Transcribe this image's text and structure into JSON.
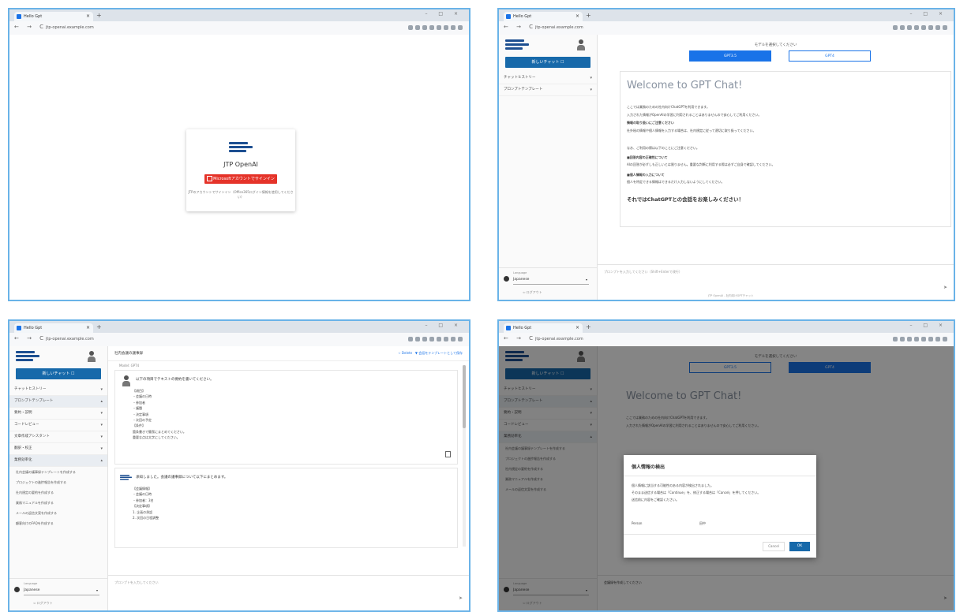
{
  "browser": {
    "tab_title": "Hello Gpt",
    "url": "jtp-openai.example.com",
    "new_tab": "+",
    "close": "×",
    "nav": "← → C",
    "window_controls": "– □ ×"
  },
  "login": {
    "app_name": "JTP OpenAI",
    "signin_button": "Microsoftアカウントでサインイン",
    "note": "JTPのアカウントでサインイン（Office365ログイン情報を使用してください）"
  },
  "sidebar": {
    "new_chat_label": "新しいチャット ☐",
    "items": [
      {
        "label": "チャットヒストリー",
        "chev": "▾"
      },
      {
        "label": "プロンプトテンプレート",
        "chev": "▾"
      }
    ],
    "items_expanded": [
      {
        "label": "チャットヒストリー",
        "chev": "▾"
      },
      {
        "label": "プロンプトテンプレート",
        "chev": "▴"
      },
      {
        "label": "要約・説明",
        "chev": "▾"
      },
      {
        "label": "コードレビュー",
        "chev": "▾"
      },
      {
        "label": "文章作成アシスタント",
        "chev": "▾"
      },
      {
        "label": "翻訳・校正",
        "chev": "▾"
      },
      {
        "label": "業務効率化",
        "chev": "▴"
      }
    ],
    "sub_items": [
      "社内会議の議事録テンプレートを作成する",
      "プロジェクトの進捗報告を作成する",
      "社内規定の要約を作成する",
      "業務マニュアルを作成する",
      "メールの返信文案を作成する",
      "顧客向けのFAQを作成する"
    ],
    "lang_label": "Language",
    "lang_value": "Japanese",
    "lang_chev": "▾",
    "logout": "⇦ ログアウト"
  },
  "welcome": {
    "model_note": "モデルを選択してください",
    "model_a": "GPT3.5",
    "model_b": "GPT4",
    "title": "Welcome to GPT Chat!",
    "lines": [
      {
        "text": "ここでは業務のための社内向けChatGPTを利用できます。",
        "bold": false
      },
      {
        "text": "入力された情報がOpenAIの学習に利用されることはありませんので安心してご利用ください。",
        "bold": false
      },
      {
        "text": "情報の取り扱いにご注意ください",
        "bold": true
      },
      {
        "text": "社外秘の情報や個人情報を入力する場合は、社内規定に従って適切に取り扱ってください。",
        "bold": false
      },
      {
        "text": "なお、ご利用の際は以下のことにご注意ください。",
        "bold": false
      },
      {
        "text": "■回答内容の正確性について",
        "bold": true
      },
      {
        "text": "AIの回答が必ずしも正しいとは限りません。重要な判断に利用する際は必ずご自身で確認してください。",
        "bold": false
      },
      {
        "text": "■個人情報の入力について",
        "bold": true
      },
      {
        "text": "個人を特定できる情報はできるだけ入力しないようにしてください。",
        "bold": false
      }
    ],
    "closing": "それではChatGPTとの会話をお楽しみください！",
    "input_placeholder": "プロンプトを入力してください（Shift+Enterで改行）",
    "send_icon": "➤",
    "footer_note": "JTP OpenAI - 社内向けGPTチャット"
  },
  "chat": {
    "title": "社内会議の議事録",
    "action_delete": "☆ Delete",
    "action_template": "▼ 会話をテンプレートとして保存",
    "model_tag": "Model: GPT4",
    "user_message": "以下の項目でテキストの要約を書いてください。",
    "user_lines": "【項目】\n・会議の日時\n・参加者\n・議題\n・決定事項\n・次回の予定\n【条件】\n箇条書きで簡潔にまとめてください。\n重要な点は太字にしてください。",
    "bot_message": "承知しました。会議の議事録について以下にまとめます。",
    "bot_lines": "【会議情報】\n・会議の日時\n・参加者：3名\n【決定事項】\n1. 企画の承認\n2. 次回の日程調整",
    "input_placeholder": "プロンプトを入力してください"
  },
  "modal": {
    "title": "個人情報の検出",
    "lines": [
      "個人情報に該当する可能性のある内容が検出されました。",
      "そのまま送信する場合は「Continue」を、修正する場合は「Cancel」を押してください。",
      "送信前に内容をご確認ください。"
    ],
    "key": "Person",
    "value": "田中",
    "cancel": "Cancel",
    "ok": "OK",
    "background_placeholder": "会議録を作成してください"
  }
}
